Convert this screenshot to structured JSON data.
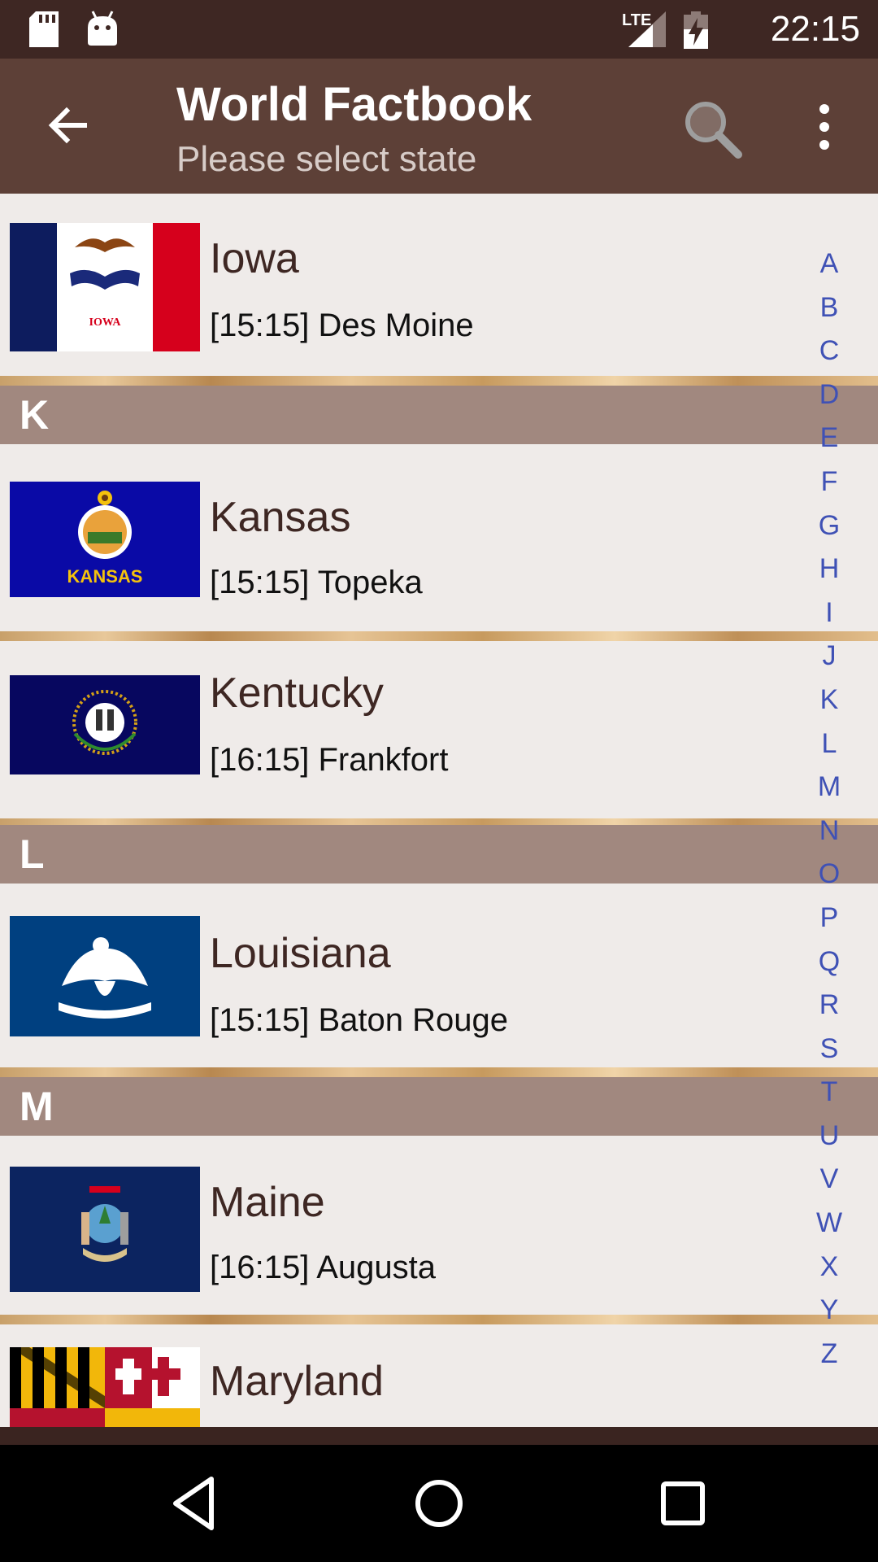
{
  "status_bar": {
    "time": "22:15",
    "network": "LTE"
  },
  "app_bar": {
    "title": "World Factbook",
    "subtitle": "Please select state"
  },
  "items": [
    {
      "type": "row",
      "name": "Iowa",
      "capital": "[15:15] Des Moine",
      "flag_icon": "iowa-flag-icon"
    },
    {
      "type": "section",
      "letter": "K"
    },
    {
      "type": "row",
      "name": "Kansas",
      "capital": "[15:15] Topeka",
      "flag_icon": "kansas-flag-icon",
      "flag_text": "KANSAS"
    },
    {
      "type": "row",
      "name": "Kentucky",
      "capital": "[16:15] Frankfort",
      "flag_icon": "kentucky-flag-icon"
    },
    {
      "type": "section",
      "letter": "L"
    },
    {
      "type": "row",
      "name": "Louisiana",
      "capital": "[15:15] Baton Rouge",
      "flag_icon": "louisiana-flag-icon"
    },
    {
      "type": "section",
      "letter": "M"
    },
    {
      "type": "row",
      "name": "Maine",
      "capital": "[16:15] Augusta",
      "flag_icon": "maine-flag-icon"
    },
    {
      "type": "row",
      "name": "Maryland",
      "capital": "",
      "flag_icon": "maryland-flag-icon"
    }
  ],
  "alphabet_index": [
    "A",
    "B",
    "C",
    "D",
    "E",
    "F",
    "G",
    "H",
    "I",
    "J",
    "K",
    "L",
    "M",
    "N",
    "O",
    "P",
    "Q",
    "R",
    "S",
    "T",
    "U",
    "V",
    "W",
    "X",
    "Y",
    "Z"
  ],
  "colors": {
    "status_bar": "#3e2723",
    "app_bar": "#5d4037",
    "section": "#a1887f",
    "row_bg": "#efebe9",
    "index_text": "#3f51b5"
  }
}
